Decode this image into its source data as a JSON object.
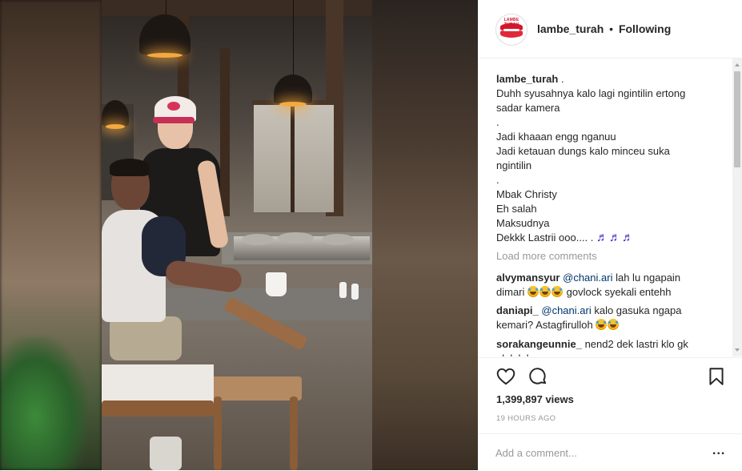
{
  "header": {
    "username": "lambe_turah",
    "separator": "•",
    "follow_status": "Following",
    "avatar_text": "LAMBE TURAH"
  },
  "caption": {
    "username": "lambe_turah",
    "first_text": ".",
    "lines": [
      "Duhh syusahnya kalo lagi ngintilin ertong",
      "sadar kamera",
      ".",
      "Jadi khaaan engg nganuu",
      "Jadi ketauan dungs kalo minceu suka",
      "ngintilin",
      ".",
      "Mbak Christy",
      "Eh salah",
      "Maksudnya"
    ],
    "last_line_text": "Dekkk Lastrii ooo.... .",
    "last_line_emoji": "♬♬♬"
  },
  "load_more": "Load more comments",
  "comments": [
    {
      "username": "alvymansyur",
      "mention": "@chani.ari",
      "text_a": "lah lu ngapain",
      "text_b": "dimari",
      "text_c": "govlock syekali entehh"
    },
    {
      "username": "daniapi_",
      "mention": "@chani.ari",
      "text_a": "kalo gasuka ngapa",
      "text_b": "kemari? Astagfirulloh"
    },
    {
      "username": "sorakangeunnie_",
      "text_a": "nend2 dek lastri klo gk",
      "text_b": "ululululu"
    }
  ],
  "actions": {
    "like_icon": "heart-icon",
    "comment_icon": "comment-icon",
    "save_icon": "bookmark-icon"
  },
  "views": "1,399,897 views",
  "timestamp": "19 HOURS AGO",
  "add_comment": {
    "placeholder": "Add a comment...",
    "more": "..."
  },
  "colors": {
    "text": "#262626",
    "muted": "#999999",
    "mention": "#003569",
    "lips": "#d5162a"
  }
}
